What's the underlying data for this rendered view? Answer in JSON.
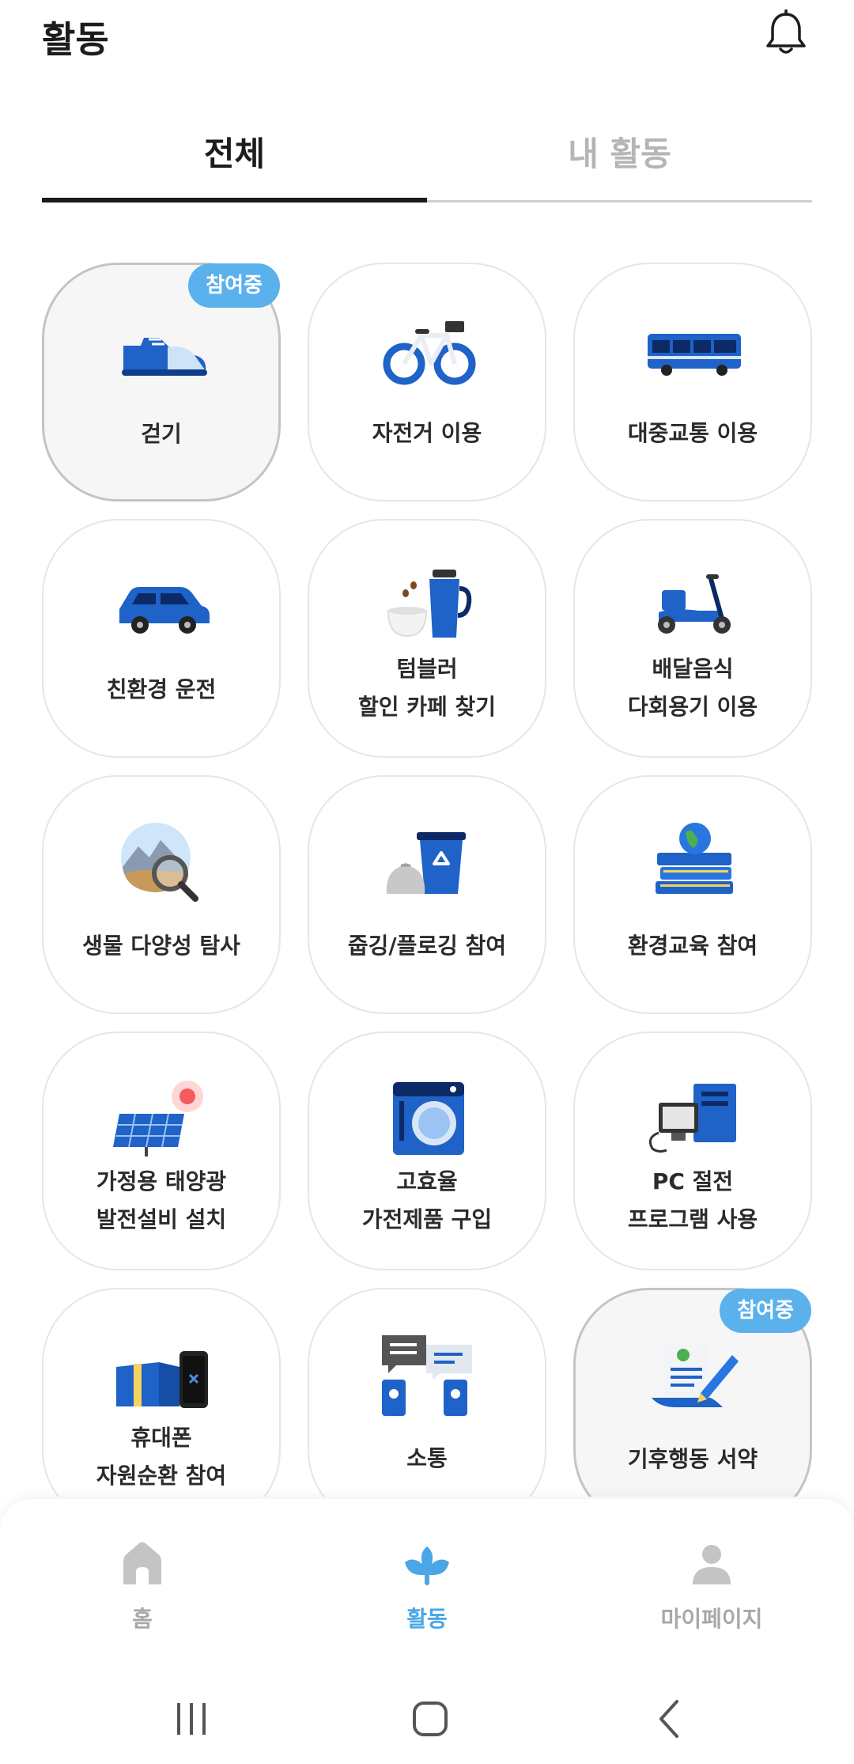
{
  "header": {
    "title": "활동",
    "bell_icon": "bell-icon"
  },
  "tabs": [
    {
      "label": "전체",
      "active": true
    },
    {
      "label": "내 활동",
      "active": false
    }
  ],
  "badge_label": "참여중",
  "activities": [
    {
      "label": "걷기",
      "icon": "sneaker-icon",
      "joined": true
    },
    {
      "label": "자전거 이용",
      "icon": "bicycle-icon",
      "joined": false
    },
    {
      "label": "대중교통 이용",
      "icon": "bus-icon",
      "joined": false
    },
    {
      "label": "친환경 운전",
      "icon": "car-icon",
      "joined": false
    },
    {
      "label": "텀블러\n할인 카페 찾기",
      "icon": "tumbler-icon",
      "joined": false
    },
    {
      "label": "배달음식\n다회용기 이용",
      "icon": "scooter-icon",
      "joined": false
    },
    {
      "label": "생물 다양성 탐사",
      "icon": "magnifier-nature-icon",
      "joined": false
    },
    {
      "label": "줍깅/플로깅 참여",
      "icon": "recycle-bin-icon",
      "joined": false
    },
    {
      "label": "환경교육 참여",
      "icon": "books-globe-icon",
      "joined": false
    },
    {
      "label": "가정용 태양광\n발전설비 설치",
      "icon": "solar-panel-icon",
      "joined": false
    },
    {
      "label": "고효율\n가전제품 구입",
      "icon": "washing-machine-icon",
      "joined": false
    },
    {
      "label": "PC 절전\n프로그램 사용",
      "icon": "pc-icon",
      "joined": false
    },
    {
      "label": "휴대폰\n자원순환 참여",
      "icon": "phone-box-icon",
      "joined": false
    },
    {
      "label": "소통",
      "icon": "chat-icon",
      "joined": false
    },
    {
      "label": "기후행동 서약",
      "icon": "pledge-icon",
      "joined": true
    }
  ],
  "bottom_nav": [
    {
      "label": "홈",
      "icon": "home-icon",
      "active": false
    },
    {
      "label": "활동",
      "icon": "activity-icon",
      "active": true
    },
    {
      "label": "마이페이지",
      "icon": "person-icon",
      "active": false
    }
  ],
  "system_nav": [
    "recent-apps-icon",
    "home-button-icon",
    "back-icon"
  ],
  "colors": {
    "accent": "#4aa6e6",
    "badge": "#5ab1ec",
    "icon_blue": "#1f62c8",
    "inactive": "#a8a8a8"
  }
}
